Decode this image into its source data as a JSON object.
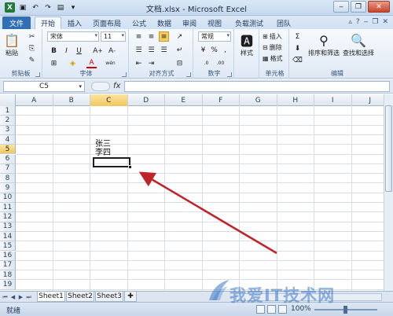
{
  "window": {
    "title": "文档.xlsx - Microsoft Excel"
  },
  "tabs": [
    {
      "label": "文件"
    },
    {
      "label": "开始"
    },
    {
      "label": "插入"
    },
    {
      "label": "页面布局"
    },
    {
      "label": "公式"
    },
    {
      "label": "数据"
    },
    {
      "label": "审阅"
    },
    {
      "label": "视图"
    },
    {
      "label": "负载测试"
    },
    {
      "label": "团队"
    }
  ],
  "ribbon": {
    "clipboard": {
      "paste": "粘贴",
      "label": "剪贴板"
    },
    "font": {
      "name": "宋体",
      "size": "11",
      "label": "字体",
      "bold": "B",
      "italic": "I",
      "underline": "U",
      "font_color_glyph": "A",
      "phonetic": "wén"
    },
    "alignment": {
      "label": "对齐方式"
    },
    "number": {
      "format": "常规",
      "label": "数字",
      "percent": "%",
      "comma": ",",
      "dec_inc": ".0",
      "dec_dec": ".00"
    },
    "styles": {
      "label": "样式",
      "button": "样式"
    },
    "cells": {
      "label": "单元格",
      "insert": "插入",
      "delete": "删除",
      "format": "格式"
    },
    "editing": {
      "label": "编辑",
      "sort": "排序和筛选",
      "find": "查找和选择",
      "sum": "Σ"
    }
  },
  "formula_bar": {
    "name_box": "C5",
    "fx": "fx",
    "value": ""
  },
  "grid": {
    "columns": [
      "A",
      "B",
      "C",
      "D",
      "E",
      "F",
      "G",
      "H",
      "I",
      "J"
    ],
    "rows": [
      "1",
      "2",
      "3",
      "4",
      "5",
      "6",
      "7",
      "8",
      "9",
      "10",
      "11",
      "12",
      "13",
      "14",
      "15",
      "16",
      "17",
      "18",
      "19"
    ],
    "selected_column": "C",
    "selected_row": "5",
    "cells": {
      "C4_line1": "张三",
      "C4_line2": "李四"
    }
  },
  "sheets": [
    {
      "label": "Sheet1"
    },
    {
      "label": "Sheet2"
    },
    {
      "label": "Sheet3"
    }
  ],
  "status": {
    "text": "就绪",
    "zoom": "100%"
  },
  "watermark": "我爱IT技术网",
  "colors": {
    "file_tab": "#2f6fb5",
    "selection_header": "#f2c75d",
    "arrow": "#c0232a"
  }
}
